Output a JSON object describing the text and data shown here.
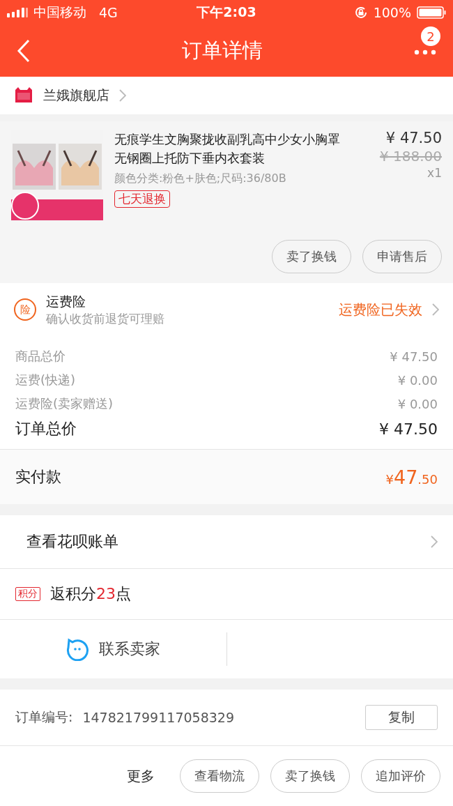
{
  "status_bar": {
    "carrier": "中国移动",
    "network": "4G",
    "time": "下午2:03",
    "battery": "100%"
  },
  "nav": {
    "title": "订单详情",
    "badge": "2"
  },
  "shop": {
    "name": "兰娥旗舰店"
  },
  "item": {
    "title": "无痕学生文胸聚拢收副乳高中少女小胸罩无钢圈上托防下垂内衣套装",
    "sku": "颜色分类:粉色+肤色;尺码:36/80B",
    "tag": "七天退换",
    "price": "¥ 47.50",
    "original_price": "¥ 188.00",
    "quantity": "x1",
    "actions": [
      "卖了换钱",
      "申请售后"
    ]
  },
  "insurance": {
    "icon": "险",
    "title": "运费险",
    "subtitle": "确认收货前退货可理赔",
    "status": "运费险已失效"
  },
  "costs": [
    {
      "label": "商品总价",
      "value": "¥ 47.50"
    },
    {
      "label": "运费(快递)",
      "value": "¥ 0.00"
    },
    {
      "label": "运费险(卖家赠送)",
      "value": "¥ 0.00"
    }
  ],
  "total": {
    "label": "订单总价",
    "value": "¥ 47.50"
  },
  "paid": {
    "label": "实付款",
    "currency": "¥",
    "integer": "47",
    "decimal": ".50"
  },
  "huabei": {
    "label": "查看花呗账单"
  },
  "points": {
    "tag": "积分",
    "prefix": "返积分",
    "amount": "23",
    "suffix": "点"
  },
  "contact": {
    "label": "联系卖家"
  },
  "order": {
    "label": "订单编号:",
    "number": "147821799117058329",
    "copy": "复制"
  },
  "bottom_bar": {
    "more": "更多",
    "buttons": [
      "查看物流",
      "卖了换钱",
      "追加评价"
    ]
  }
}
